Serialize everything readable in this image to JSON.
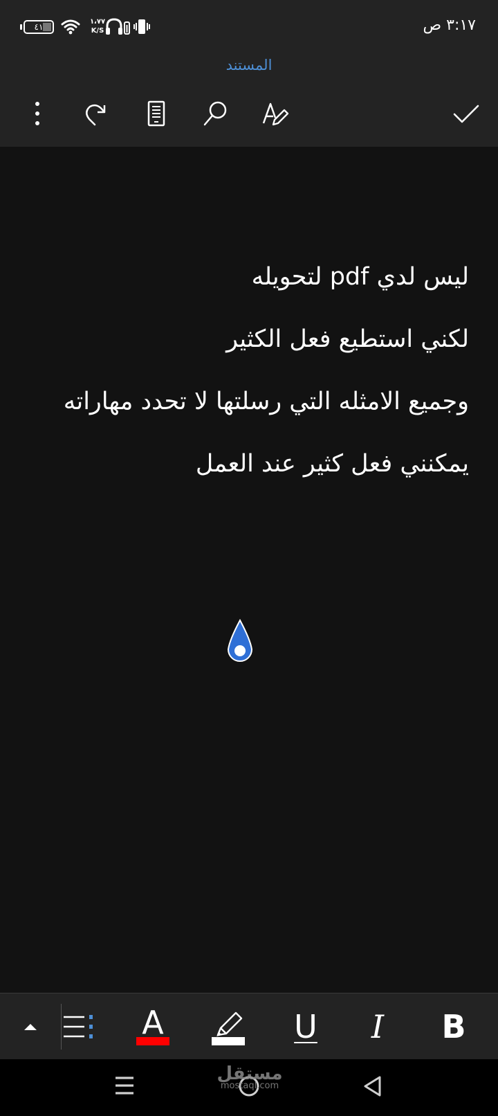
{
  "status_bar": {
    "time": "٣:١٧ ص",
    "battery_level": "٤١",
    "net_speed_value": "١،٧٧",
    "net_speed_unit": "K/S",
    "icons": [
      "battery-icon",
      "wifi-icon",
      "headphones-icon",
      "vibrate-icon"
    ]
  },
  "header": {
    "title": "المستند",
    "title_color": "#4d8fd6"
  },
  "toolbar": {
    "icons": [
      "more-options-icon",
      "redo-icon",
      "mobile-view-icon",
      "search-icon",
      "draw-icon",
      "done-check-icon"
    ]
  },
  "document": {
    "lines": [
      "ليس لدي pdf لتحويله",
      "لكني استطيع فعل الكثير",
      "وجميع الامثله التي رسلتها لا تحدد مهاراته",
      "يمكنني فعل كثير عند العمل"
    ]
  },
  "format_bar": {
    "font_color_label": "A",
    "font_color": "#ff0000",
    "highlight_color": "#ffffff",
    "underline_label": "U",
    "italic_label": "I",
    "bold_label": "B",
    "icons": [
      "expand-up-icon",
      "bullet-list-icon",
      "font-color-icon",
      "highlighter-icon"
    ]
  },
  "nav_bar": {
    "icons": [
      "recent-apps-icon",
      "home-icon",
      "back-icon"
    ]
  },
  "watermark": {
    "arabic": "مستقل",
    "latin": "mostaql.com"
  }
}
